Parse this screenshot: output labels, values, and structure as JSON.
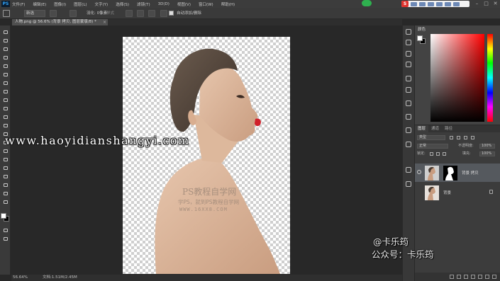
{
  "menubar": {
    "logo": "PS",
    "items": [
      "文件(F)",
      "编辑(E)",
      "图像(I)",
      "图层(L)",
      "文字(Y)",
      "选择(S)",
      "滤镜(T)",
      "3D(D)",
      "视图(V)",
      "窗口(W)",
      "帮助(H)"
    ],
    "ime_logo": "S",
    "window_controls": [
      "–",
      "□",
      "✕"
    ]
  },
  "optionsbar": {
    "mode_select": "新选",
    "feather_label": "羽化: 0像素",
    "antialias_label": "消除锯齿",
    "style_label": "样式",
    "auto_label": "自动添加/删除"
  },
  "tab": {
    "title": "人物.png @ 56.6% (背景 拷贝, 图层蒙版/8) *"
  },
  "canvas": {
    "url_watermark": "www.haoyidianshangyi.com",
    "wm_line1": "PS教程自学网",
    "wm_line2": "学PS，就到PS教程自学网",
    "wm_line3": "WWW.16XX8.COM"
  },
  "statusbar": {
    "zoom": "56.64%",
    "docsize": "文档:1.51M/2.45M"
  },
  "color_panel": {
    "title": "颜色",
    "hue_color": "#ff0000"
  },
  "layers_panel": {
    "tabs": [
      "图层",
      "通道",
      "路径"
    ],
    "kind_filter": "类型",
    "blend_mode": "正常",
    "opacity_label": "不透明度:",
    "opacity_value": "100%",
    "lock_label": "锁定:",
    "fill_label": "填充:",
    "fill_value": "100%",
    "layers": [
      {
        "name": "背景 拷贝",
        "has_mask": true
      },
      {
        "name": "背景",
        "locked": true
      }
    ]
  },
  "social": {
    "handle": "@卡乐筠",
    "account": "公众号：卡乐筠"
  }
}
